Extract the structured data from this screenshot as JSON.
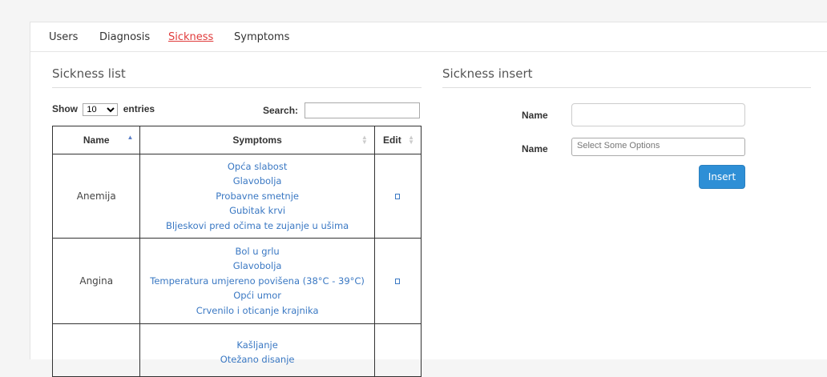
{
  "nav": {
    "items": [
      {
        "label": "Users"
      },
      {
        "label": "Diagnosis"
      },
      {
        "label": "Sickness"
      },
      {
        "label": "Symptoms"
      }
    ],
    "active_index": 2
  },
  "list_section": {
    "title": "Sickness list",
    "show_label": "Show",
    "page_size": "10",
    "entries_label": "entries",
    "search_label": "Search:",
    "search_value": "",
    "columns": [
      "Name",
      "Symptoms",
      "Edit"
    ],
    "rows": [
      {
        "name": "Anemija",
        "symptoms": [
          "Opća slabost",
          "Glavobolja",
          "Probavne smetnje",
          "Gubitak krvi",
          "Bljeskovi pred očima te zujanje u ušima"
        ]
      },
      {
        "name": "Angina",
        "symptoms": [
          "Bol u grlu",
          "Glavobolja",
          "Temperatura umjereno povišena (38°C - 39°C)",
          "Opći umor",
          "Crvenilo i oticanje krajnika"
        ]
      },
      {
        "name": "",
        "symptoms": [
          "Kašljanje",
          "Otežano disanje"
        ]
      }
    ]
  },
  "insert_section": {
    "title": "Sickness insert",
    "name_label": "Name",
    "name_value": "",
    "symptoms_label": "Name",
    "symptoms_placeholder": "Select Some Options",
    "insert_label": "Insert"
  },
  "colors": {
    "accent": "#2e8fd6",
    "link": "#3a78c3",
    "active_nav": "#e03b3b"
  }
}
